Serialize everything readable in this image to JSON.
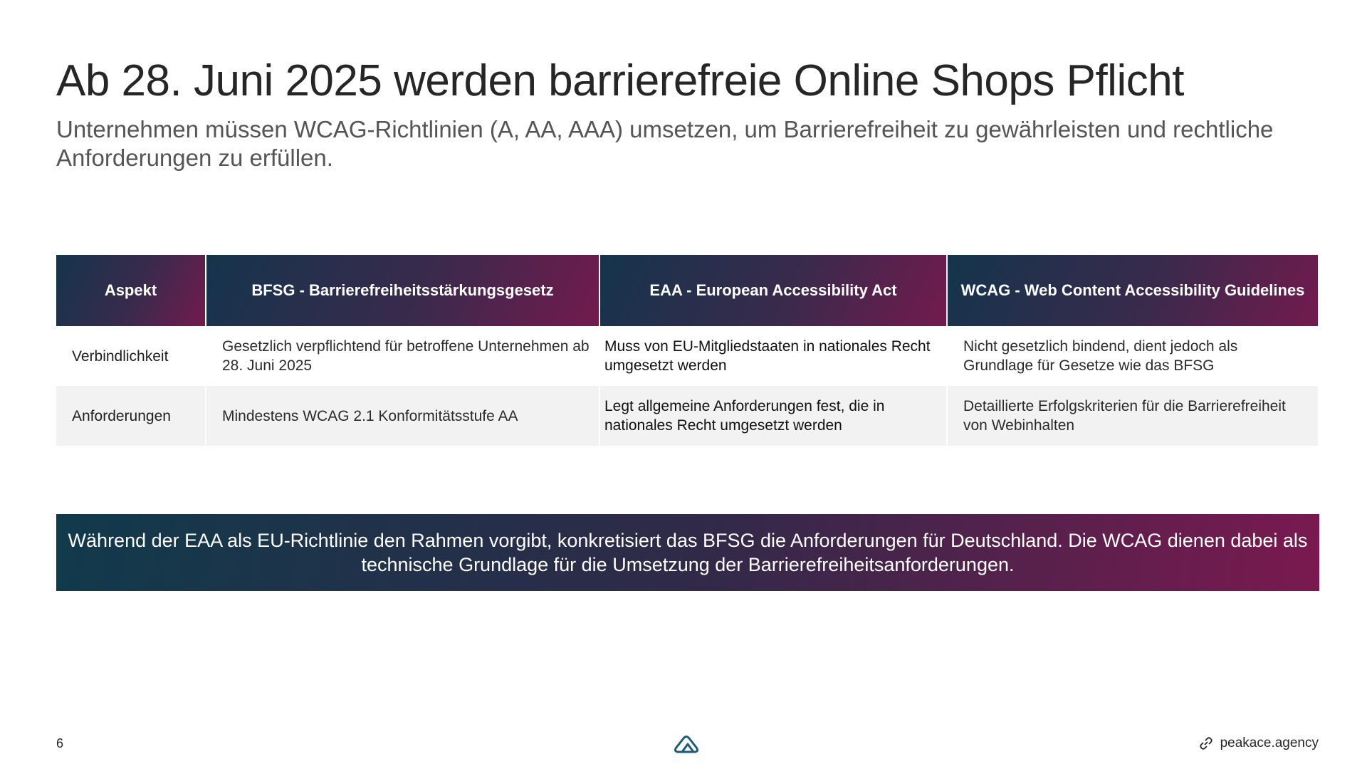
{
  "slide": {
    "title": "Ab 28. Juni 2025 werden barrierefreie Online Shops Pflicht",
    "subtitle": "Unternehmen müssen WCAG-Richtlinien (A, AA, AAA) umsetzen, um Barrierefreiheit zu gewährleisten und rechtliche Anforderungen zu erfüllen."
  },
  "table": {
    "headers": [
      "Aspekt",
      "BFSG - Barrierefreiheitsstärkungsgesetz",
      "EAA - European Accessibility Act",
      "WCAG - Web Content Accessibility Guidelines"
    ],
    "rows": [
      {
        "aspect": "Verbindlichkeit",
        "bfsg": "Gesetzlich verpflichtend für betroffene Unternehmen ab 28. Juni 2025",
        "eaa": "Muss von EU-Mitgliedstaaten in nationales Recht umgesetzt werden",
        "wcag": "Nicht gesetzlich bindend, dient jedoch als Grundlage für Gesetze wie das BFSG"
      },
      {
        "aspect": "Anforderungen",
        "bfsg": "Mindestens WCAG 2.1 Konformitätsstufe AA",
        "eaa": "Legt allgemeine Anforderungen fest, die in nationales Recht umgesetzt werden",
        "wcag": "Detaillierte Erfolgskriterien für die Barrierefreiheit von Webinhalten"
      }
    ]
  },
  "banner": {
    "text": "Während der EAA als EU-Richtlinie den Rahmen vorgibt, konkretisiert das BFSG die Anforderungen für Deutschland. Die WCAG dienen dabei als technische Grundlage für die Umsetzung der Barrierefreiheitsanforderungen."
  },
  "footer": {
    "page_number": "6",
    "logo_icon": "peakace-logo-icon",
    "link_icon": "link-icon",
    "link_text": "peakace.agency"
  },
  "colors": {
    "gradient_start": "#14344c",
    "gradient_end": "#731a4e",
    "row_alt": "#f2f2f2",
    "logo": "#1d5c78"
  }
}
